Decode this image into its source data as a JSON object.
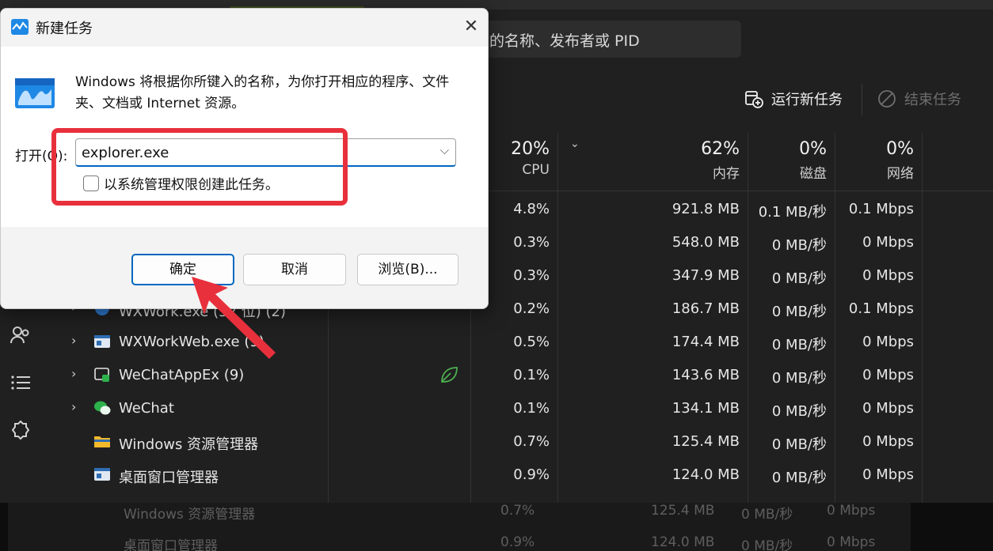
{
  "search": {
    "text": "的名称、发布者或 PID"
  },
  "actions": {
    "run_new_task": "运行新任务",
    "end_task": "结束任务"
  },
  "columns": [
    {
      "pct": "20%",
      "label": "CPU"
    },
    {
      "pct": "62%",
      "label": "内存"
    },
    {
      "pct": "0%",
      "label": "磁盘"
    },
    {
      "pct": "0%",
      "label": "网络"
    }
  ],
  "rows": [
    {
      "name": "",
      "cpu": "4.8%",
      "mem": "921.8 MB",
      "disk": "0.1 MB/秒",
      "net": "0.1 Mbps"
    },
    {
      "name": "",
      "cpu": "0.3%",
      "mem": "548.0 MB",
      "disk": "0 MB/秒",
      "net": "0 Mbps"
    },
    {
      "name": "",
      "cpu": "0.3%",
      "mem": "347.9 MB",
      "disk": "0 MB/秒",
      "net": "0 Mbps"
    },
    {
      "name": "WXWork.exe (32 位) (2)",
      "cpu": "0.2%",
      "mem": "186.7 MB",
      "disk": "0 MB/秒",
      "net": "0.1 Mbps"
    },
    {
      "name": "WXWorkWeb.exe (9)",
      "cpu": "0.5%",
      "mem": "174.4 MB",
      "disk": "0 MB/秒",
      "net": "0 Mbps"
    },
    {
      "name": "WeChatAppEx (9)",
      "cpu": "0.1%",
      "mem": "143.6 MB",
      "disk": "0 MB/秒",
      "net": "0 Mbps"
    },
    {
      "name": "WeChat",
      "cpu": "0.1%",
      "mem": "134.1 MB",
      "disk": "0 MB/秒",
      "net": "0 Mbps"
    },
    {
      "name": "Windows 资源管理器",
      "cpu": "0.7%",
      "mem": "125.4 MB",
      "disk": "0 MB/秒",
      "net": "0 Mbps"
    },
    {
      "name": "桌面窗口管理器",
      "cpu": "0.9%",
      "mem": "124.0 MB",
      "disk": "0 MB/秒",
      "net": "0 Mbps"
    }
  ],
  "dim_rows": [
    {
      "name": "Windows 资源管理器",
      "cpu": "0.7%",
      "mem": "125.4 MB",
      "disk": "0 MB/秒",
      "net": "0 Mbps"
    },
    {
      "name": "桌面窗口管理器",
      "cpu": "0.9%",
      "mem": "124.0 MB",
      "disk": "0 MB/秒",
      "net": "0 Mbps"
    }
  ],
  "dialog": {
    "title": "新建任务",
    "description": "Windows 将根据你所键入的名称，为你打开相应的程序、文件夹、文档或 Internet 资源。",
    "open_label": "打开(O):",
    "open_value": "explorer.exe",
    "admin_checkbox": "以系统管理权限创建此任务。",
    "ok": "确定",
    "cancel": "取消",
    "browse": "浏览(B)..."
  },
  "colors": {
    "accent": "#0067c0",
    "annotation": "#e8303c",
    "leaf": "#4caf50"
  }
}
